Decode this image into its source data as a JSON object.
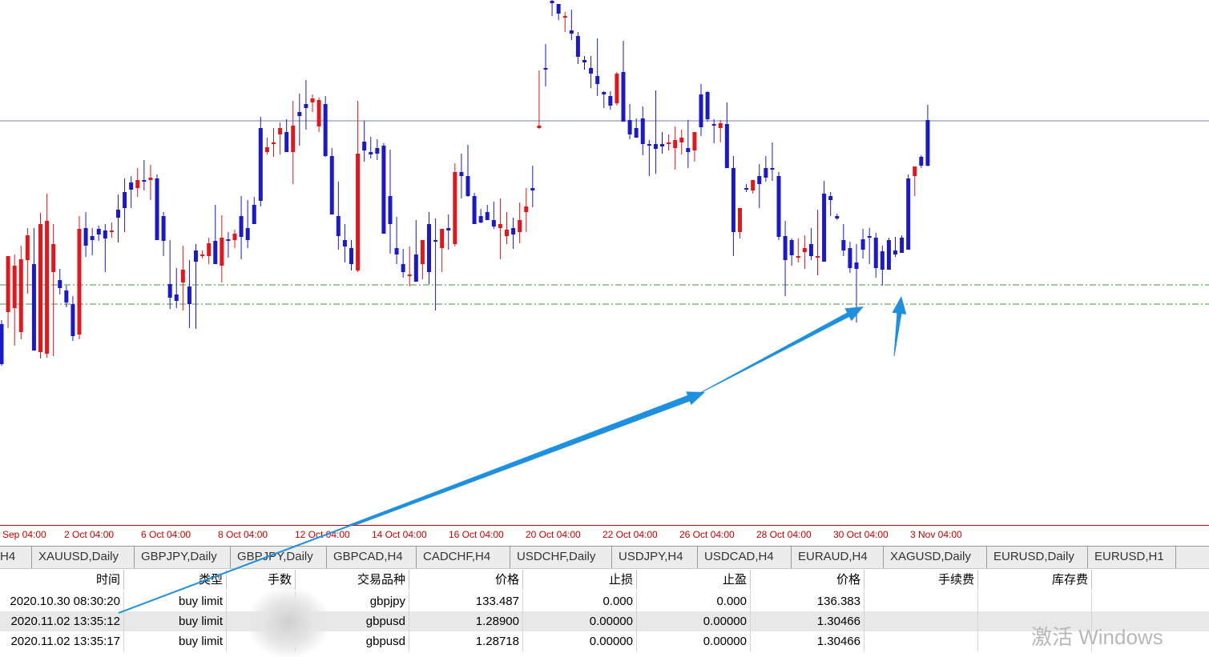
{
  "chart": {
    "candles": [
      [
        405,
        400,
        457,
        455
      ],
      [
        390,
        330,
        410,
        320
      ],
      [
        385,
        318,
        432,
        332
      ],
      [
        415,
        307,
        424,
        324
      ],
      [
        325,
        285,
        367,
        294
      ],
      [
        330,
        285,
        355,
        438
      ],
      [
        440,
        266,
        448,
        280
      ],
      [
        442,
        242,
        447,
        276
      ],
      [
        340,
        280,
        445,
        305
      ],
      [
        350,
        336,
        368,
        360
      ],
      [
        363,
        357,
        384,
        378
      ],
      [
        380,
        370,
        426,
        420
      ],
      [
        418,
        270,
        424,
        286
      ],
      [
        285,
        265,
        321,
        307
      ],
      [
        295,
        285,
        319,
        300
      ],
      [
        286,
        282,
        301,
        293
      ],
      [
        288,
        280,
        340,
        298
      ],
      [
        290,
        278,
        297,
        288
      ],
      [
        262,
        243,
        303,
        272
      ],
      [
        240,
        223,
        290,
        260
      ],
      [
        228,
        220,
        260,
        237
      ],
      [
        235,
        210,
        246,
        225
      ],
      [
        225,
        200,
        238,
        226
      ],
      [
        225,
        206,
        250,
        222
      ],
      [
        223,
        218,
        263,
        300
      ],
      [
        270,
        265,
        320,
        301
      ],
      [
        355,
        300,
        386,
        372
      ],
      [
        368,
        335,
        385,
        376
      ],
      [
        353,
        307,
        388,
        337
      ],
      [
        358,
        325,
        410,
        380
      ],
      [
        313,
        305,
        411,
        327
      ],
      [
        320,
        313,
        323,
        318
      ],
      [
        320,
        297,
        330,
        304
      ],
      [
        301,
        256,
        325,
        330
      ],
      [
        332,
        269,
        353,
        297
      ],
      [
        299,
        290,
        322,
        300
      ],
      [
        300,
        287,
        310,
        292
      ],
      [
        270,
        245,
        324,
        296
      ],
      [
        285,
        250,
        310,
        300
      ],
      [
        256,
        246,
        272,
        280
      ],
      [
        160,
        146,
        258,
        251
      ],
      [
        190,
        172,
        193,
        184
      ],
      [
        180,
        160,
        196,
        178
      ],
      [
        168,
        153,
        193,
        160
      ],
      [
        165,
        149,
        190,
        190
      ],
      [
        190,
        126,
        230,
        157
      ],
      [
        140,
        117,
        182,
        145
      ],
      [
        130,
        100,
        162,
        135
      ],
      [
        128,
        118,
        140,
        123
      ],
      [
        158,
        122,
        165,
        125
      ],
      [
        130,
        120,
        196,
        195
      ],
      [
        195,
        185,
        265,
        268
      ],
      [
        270,
        227,
        312,
        295
      ],
      [
        300,
        280,
        328,
        308
      ],
      [
        310,
        300,
        338,
        330
      ],
      [
        338,
        126,
        340,
        192
      ],
      [
        177,
        151,
        202,
        188
      ],
      [
        190,
        171,
        198,
        193
      ],
      [
        185,
        174,
        200,
        192
      ],
      [
        182,
        179,
        230,
        292
      ],
      [
        245,
        187,
        317,
        280
      ],
      [
        310,
        271,
        330,
        318
      ],
      [
        330,
        311,
        347,
        340
      ],
      [
        345,
        308,
        358,
        343
      ],
      [
        318,
        275,
        351,
        352
      ],
      [
        330,
        303,
        349,
        300
      ],
      [
        280,
        265,
        355,
        340
      ],
      [
        300,
        273,
        388,
        302
      ],
      [
        310,
        287,
        340,
        286
      ],
      [
        285,
        268,
        312,
        288
      ],
      [
        305,
        204,
        308,
        215
      ],
      [
        215,
        192,
        248,
        220
      ],
      [
        220,
        181,
        246,
        245
      ],
      [
        245,
        241,
        260,
        280
      ],
      [
        270,
        261,
        279,
        278
      ],
      [
        265,
        256,
        273,
        275
      ],
      [
        275,
        252,
        286,
        283
      ],
      [
        285,
        248,
        324,
        280
      ],
      [
        295,
        265,
        305,
        287
      ],
      [
        285,
        272,
        311,
        293
      ],
      [
        290,
        253,
        304,
        275
      ],
      [
        265,
        235,
        290,
        258
      ],
      [
        235,
        207,
        259,
        238
      ],
      [
        160,
        88,
        161,
        157
      ],
      [
        85,
        55,
        108,
        87
      ],
      [
        1,
        -4,
        20,
        4
      ],
      [
        5,
        5,
        25,
        17
      ],
      [
        22,
        15,
        40,
        20
      ],
      [
        38,
        12,
        50,
        42
      ],
      [
        45,
        40,
        80,
        71
      ],
      [
        75,
        70,
        87,
        78
      ],
      [
        85,
        70,
        110,
        92
      ],
      [
        95,
        48,
        120,
        105
      ],
      [
        115,
        114,
        135,
        118
      ],
      [
        120,
        114,
        137,
        132
      ],
      [
        129,
        90,
        132,
        92
      ],
      [
        90,
        51,
        144,
        152
      ],
      [
        150,
        130,
        174,
        168
      ],
      [
        160,
        148,
        171,
        172
      ],
      [
        148,
        133,
        194,
        180
      ],
      [
        180,
        175,
        220,
        182
      ],
      [
        180,
        113,
        217,
        186
      ],
      [
        180,
        165,
        192,
        183
      ],
      [
        180,
        168,
        188,
        178
      ],
      [
        185,
        158,
        212,
        175
      ],
      [
        178,
        162,
        193,
        172
      ],
      [
        185,
        150,
        210,
        190
      ],
      [
        188,
        170,
        202,
        165
      ],
      [
        118,
        105,
        170,
        159
      ],
      [
        115,
        114,
        152,
        149
      ],
      [
        155,
        149,
        179,
        157
      ],
      [
        160,
        150,
        178,
        154
      ],
      [
        155,
        128,
        195,
        210
      ],
      [
        210,
        195,
        320,
        290
      ],
      [
        290,
        260,
        298,
        260
      ],
      [
        235,
        230,
        240,
        235
      ],
      [
        238,
        226,
        242,
        225
      ],
      [
        220,
        205,
        260,
        230
      ],
      [
        210,
        195,
        227,
        222
      ],
      [
        210,
        178,
        226,
        211
      ],
      [
        220,
        215,
        300,
        296
      ],
      [
        295,
        276,
        370,
        325
      ],
      [
        300,
        298,
        332,
        319
      ],
      [
        322,
        298,
        328,
        320
      ],
      [
        315,
        294,
        336,
        310
      ],
      [
        305,
        285,
        325,
        320
      ],
      [
        322,
        262,
        344,
        320
      ],
      [
        242,
        226,
        269,
        327
      ],
      [
        245,
        240,
        270,
        250
      ],
      [
        270,
        267,
        275,
        273
      ],
      [
        300,
        280,
        320,
        313
      ],
      [
        310,
        302,
        341,
        335
      ],
      [
        328,
        305,
        403,
        336
      ],
      [
        299,
        286,
        323,
        312
      ],
      [
        295,
        285,
        330,
        297
      ],
      [
        297,
        291,
        347,
        335
      ],
      [
        314,
        307,
        357,
        337
      ],
      [
        300,
        297,
        325,
        337
      ],
      [
        313,
        296,
        321,
        318
      ],
      [
        297,
        294,
        313,
        316
      ],
      [
        223,
        218,
        310,
        312
      ],
      [
        220,
        215,
        245,
        208
      ],
      [
        196,
        194,
        210,
        207
      ],
      [
        150,
        131,
        208,
        207
      ]
    ],
    "reference_levels": [
      {
        "kind": "current-price",
        "color": "#7b7fa6"
      },
      {
        "kind": "order-level-1",
        "color": "#3d9a3d"
      },
      {
        "kind": "order-level-2",
        "color": "#3d9a3d"
      }
    ],
    "bull_color": "#e3161b",
    "bear_color": "#1a1acb",
    "arrow_color": "#1e90e0"
  },
  "time_axis": {
    "labels": [
      "Sep 04:00",
      "2 Oct 04:00",
      "6 Oct 04:00",
      "8 Oct 04:00",
      "12 Oct 04:00",
      "14 Oct 04:00",
      "16 Oct 04:00",
      "20 Oct 04:00",
      "22 Oct 04:00",
      "26 Oct 04:00",
      "28 Oct 04:00",
      "30 Oct 04:00",
      "3 Nov 04:00"
    ]
  },
  "tabs": [
    "H4",
    "XAUUSD,Daily",
    "GBPJPY,Daily",
    "GBPJPY,Daily",
    "GBPCAD,H4",
    "CADCHF,H4",
    "USDCHF,Daily",
    "USDJPY,H4",
    "USDCAD,H4",
    "EURAUD,H4",
    "XAGUSD,Daily",
    "EURUSD,Daily",
    "EURUSD,H1"
  ],
  "table": {
    "headers": [
      "时间",
      "类型",
      "手数",
      "交易品种",
      "价格",
      "止损",
      "止盈",
      "价格",
      "手续费",
      "库存费"
    ],
    "rows": [
      [
        "2020.10.30 08:30:20",
        "buy limit",
        "",
        "gbpjpy",
        "133.487",
        "0.000",
        "0.000",
        "136.383",
        "",
        ""
      ],
      [
        "2020.11.02 13:35:12",
        "buy limit",
        "",
        "gbpusd",
        "1.28900",
        "0.00000",
        "0.00000",
        "1.30466",
        "",
        ""
      ],
      [
        "2020.11.02 13:35:17",
        "buy limit",
        "",
        "gbpusd",
        "1.28718",
        "0.00000",
        "0.00000",
        "1.30466",
        "",
        ""
      ]
    ]
  },
  "watermark": "激活 Windows"
}
